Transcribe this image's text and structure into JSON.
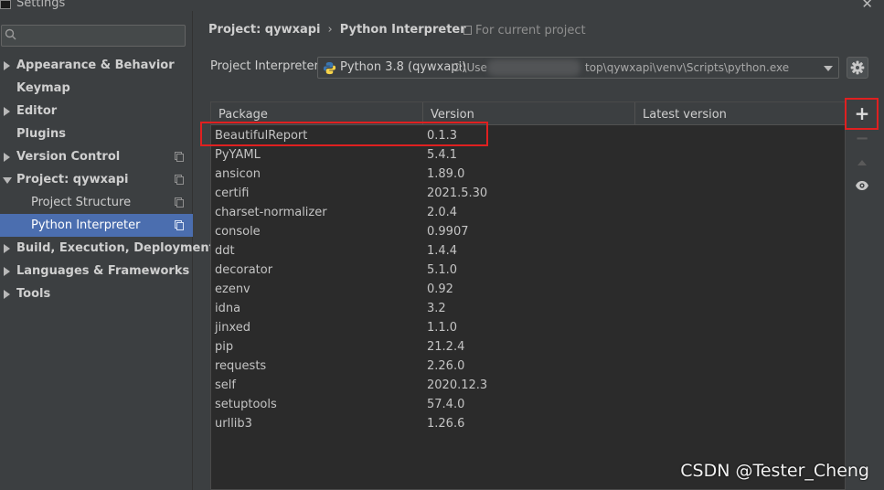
{
  "window": {
    "title": "Settings"
  },
  "search": {
    "placeholder": ""
  },
  "sidebar": {
    "items": [
      {
        "label": "Appearance & Behavior",
        "expand": "collapsed",
        "level": 0
      },
      {
        "label": "Keymap",
        "expand": "none",
        "level": 0
      },
      {
        "label": "Editor",
        "expand": "collapsed",
        "level": 0
      },
      {
        "label": "Plugins",
        "expand": "none",
        "level": 0
      },
      {
        "label": "Version Control",
        "expand": "collapsed",
        "level": 0,
        "copy_icon": true
      },
      {
        "label": "Project: qywxapi",
        "expand": "expanded",
        "level": 0,
        "copy_icon": true
      },
      {
        "label": "Project Structure",
        "expand": "none",
        "level": 1,
        "copy_icon": true
      },
      {
        "label": "Python Interpreter",
        "expand": "none",
        "level": 1,
        "copy_icon": true,
        "selected": true
      },
      {
        "label": "Build, Execution, Deployment",
        "expand": "collapsed",
        "level": 0
      },
      {
        "label": "Languages & Frameworks",
        "expand": "collapsed",
        "level": 0
      },
      {
        "label": "Tools",
        "expand": "collapsed",
        "level": 0
      }
    ]
  },
  "breadcrumb": {
    "project": "Project: qywxapi",
    "separator": "›",
    "page": "Python Interpreter"
  },
  "scope": {
    "label": "For current project"
  },
  "interpreter": {
    "label": "Project Interpreter:",
    "name": "Python 3.8 (qywxapi)",
    "path_start": "C:\\Use",
    "path_end": "top\\qywxapi\\venv\\Scripts\\python.exe"
  },
  "table": {
    "columns": [
      "Package",
      "Version",
      "Latest version"
    ],
    "rows": [
      {
        "package": "BeautifulReport",
        "version": "0.1.3",
        "latest": ""
      },
      {
        "package": "PyYAML",
        "version": "5.4.1",
        "latest": ""
      },
      {
        "package": "ansicon",
        "version": "1.89.0",
        "latest": ""
      },
      {
        "package": "certifi",
        "version": "2021.5.30",
        "latest": ""
      },
      {
        "package": "charset-normalizer",
        "version": "2.0.4",
        "latest": ""
      },
      {
        "package": "console",
        "version": "0.9907",
        "latest": ""
      },
      {
        "package": "ddt",
        "version": "1.4.4",
        "latest": ""
      },
      {
        "package": "decorator",
        "version": "5.1.0",
        "latest": ""
      },
      {
        "package": "ezenv",
        "version": "0.92",
        "latest": ""
      },
      {
        "package": "idna",
        "version": "3.2",
        "latest": ""
      },
      {
        "package": "jinxed",
        "version": "1.1.0",
        "latest": ""
      },
      {
        "package": "pip",
        "version": "21.2.4",
        "latest": ""
      },
      {
        "package": "requests",
        "version": "2.26.0",
        "latest": ""
      },
      {
        "package": "self",
        "version": "2020.12.3",
        "latest": ""
      },
      {
        "package": "setuptools",
        "version": "57.4.0",
        "latest": ""
      },
      {
        "package": "urllib3",
        "version": "1.26.6",
        "latest": ""
      }
    ]
  },
  "toolbar": {
    "add_label": "+",
    "remove_label": "−"
  },
  "watermark": {
    "text": "CSDN @Tester_Cheng"
  },
  "colors": {
    "background": "#3c3f41",
    "table_bg": "#2b2b2b",
    "selection": "#4b6eaf",
    "annotation_red": "#e02020"
  }
}
